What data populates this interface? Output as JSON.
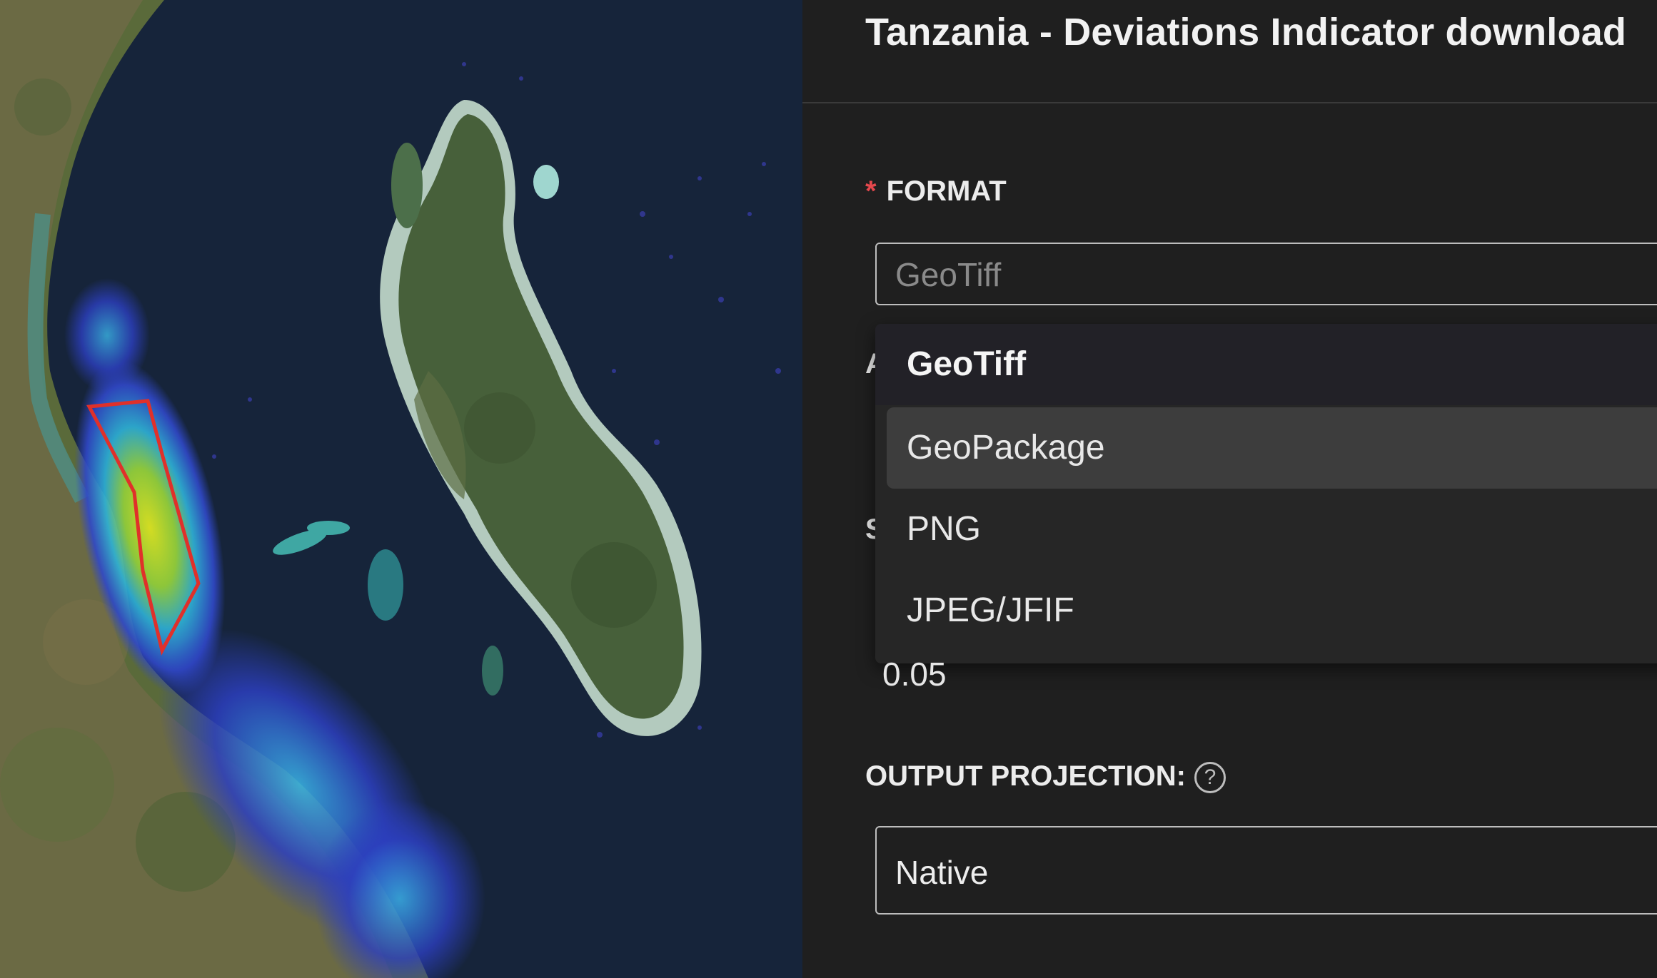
{
  "dialog": {
    "title": "Tanzania - Deviations Indicator download"
  },
  "format_field": {
    "required_mark": "*",
    "label": "FORMAT",
    "placeholder": "GeoTiff",
    "options": [
      {
        "label": "GeoTiff",
        "state": "selected"
      },
      {
        "label": "GeoPackage",
        "state": "hovered"
      },
      {
        "label": "PNG",
        "state": "normal"
      },
      {
        "label": "JPEG/JFIF",
        "state": "normal"
      }
    ]
  },
  "hidden_fields": {
    "partial_label_1": "A",
    "partial_label_2": "S",
    "value": "0.05"
  },
  "projection_field": {
    "label": "OUTPUT PROJECTION:",
    "help_icon": "question-circle-icon",
    "value": "Native"
  },
  "map": {
    "aoi_outline_color": "#e0302a"
  }
}
